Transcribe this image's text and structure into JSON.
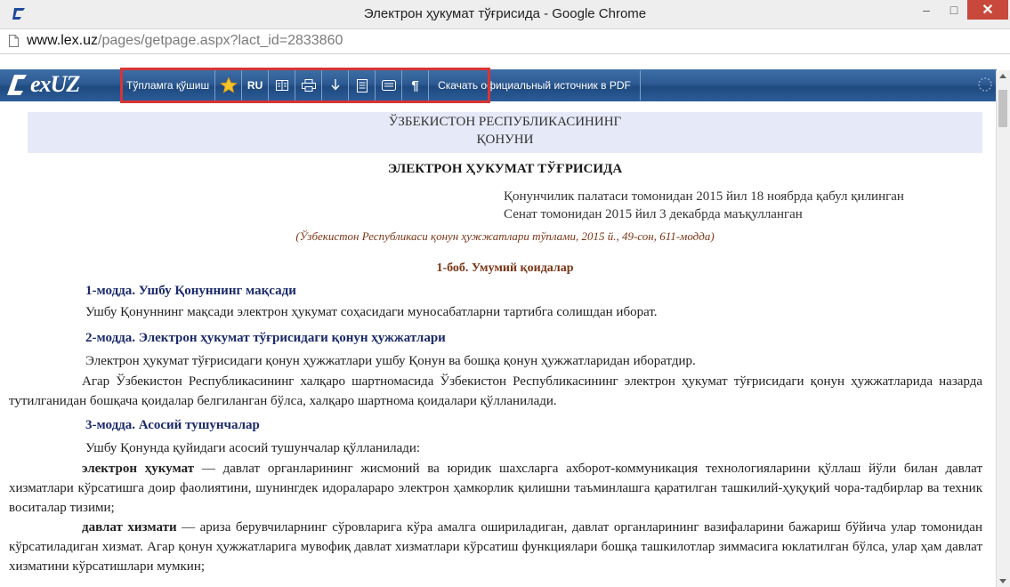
{
  "window": {
    "title": "Электрон ҳукумат тўғрисида - Google Chrome",
    "minimize": "–",
    "maximize": "□",
    "close": "✕"
  },
  "address": {
    "domain": "www.lex.uz",
    "path": "/pages/getpage.aspx?lact_id=2833860"
  },
  "toolbar": {
    "logo": "exUZ",
    "add_to_collection": "Тўпламга қўшиш",
    "icons": [
      "star-icon",
      "ru-language",
      "columns-icon",
      "print-icon",
      "download-icon",
      "document-icon",
      "comment-icon",
      "pilcrow-icon"
    ],
    "ru_label": "RU",
    "pilcrow": "¶",
    "pdf_label": "Скачать официальный источник в PDF"
  },
  "document": {
    "header_line1": "ЎЗБЕКИСТОН РЕСПУБЛИКАСИНИНГ",
    "header_line2": "ҚОНУНИ",
    "title": "ЭЛЕКТРОН ҲУКУМАТ ТЎҒРИСИДА",
    "adopted_line1": "Қонунчилик палатаси томонидан 2015 йил 18 ноябрда қабул қилинган",
    "adopted_line2": "Сенат томонидан 2015 йил 3 декабрда маъқулланган",
    "source": "(Ўзбекистон Республикаси қонун ҳужжатлари тўплами, 2015 й., 49-сон, 611-модда)",
    "chapter1": "1-боб. Умумий қоидалар",
    "art1_title": "1-модда. Ушбу Қонуннинг мақсади",
    "art1_text": "Ушбу Қонуннинг мақсади электрон ҳукумат соҳасидаги муносабатларни тартибга солишдан иборат.",
    "art2_title": "2-модда. Электрон ҳукумат тўғрисидаги қонун ҳужжатлари",
    "art2_text1": "Электрон ҳукумат тўғрисидаги қонун ҳужжатлари ушбу Қонун ва бошқа қонун ҳужжатларидан иборатдир.",
    "art2_text2": "Агар Ўзбекистон Республикасининг халқаро шартномасида Ўзбекистон Республикасининг электрон ҳукумат тўғрисидаги қонун ҳужжатларида назарда тутилганидан бошқача қоидалар белгиланган бўлса, халқаро шартнома қоидалари қўлланилади.",
    "art3_title": "3-модда. Асосий тушунчалар",
    "art3_intro": "Ушбу Қонунда қуйидаги асосий тушунчалар қўлланилади:",
    "term1": "электрон ҳукумат",
    "term1_def": " — давлат органларининг жисмоний ва юридик шахсларга ахборот-коммуникация технологияларини қўллаш йўли билан давлат хизматлари кўрсатишга доир фаолиятини, шунингдек идоралараро электрон ҳамкорлик қилишни таъминлашга қаратилган ташкилий-ҳуқуқий чора-тадбирлар ва техник воситалар тизими;",
    "term2": "давлат хизмати",
    "term2_def": " — ариза берувчиларнинг сўровларига кўра амалга ошириладиган, давлат органларининг вазифаларини бажариш бўйича улар томонидан кўрсатиладиган хизмат. Агар қонун ҳужжатларига мувофиқ давлат хизматлари кўрсатиш функциялари бошқа ташкилотлар зиммасига юклатилган бўлса, улар ҳам давлат хизматини кўрсатишлари мумкин;"
  },
  "colors": {
    "toolbar": "#2d5a92",
    "highlight": "#d83434",
    "article_heading": "#1b2a6b",
    "chapter": "#7a3515"
  }
}
